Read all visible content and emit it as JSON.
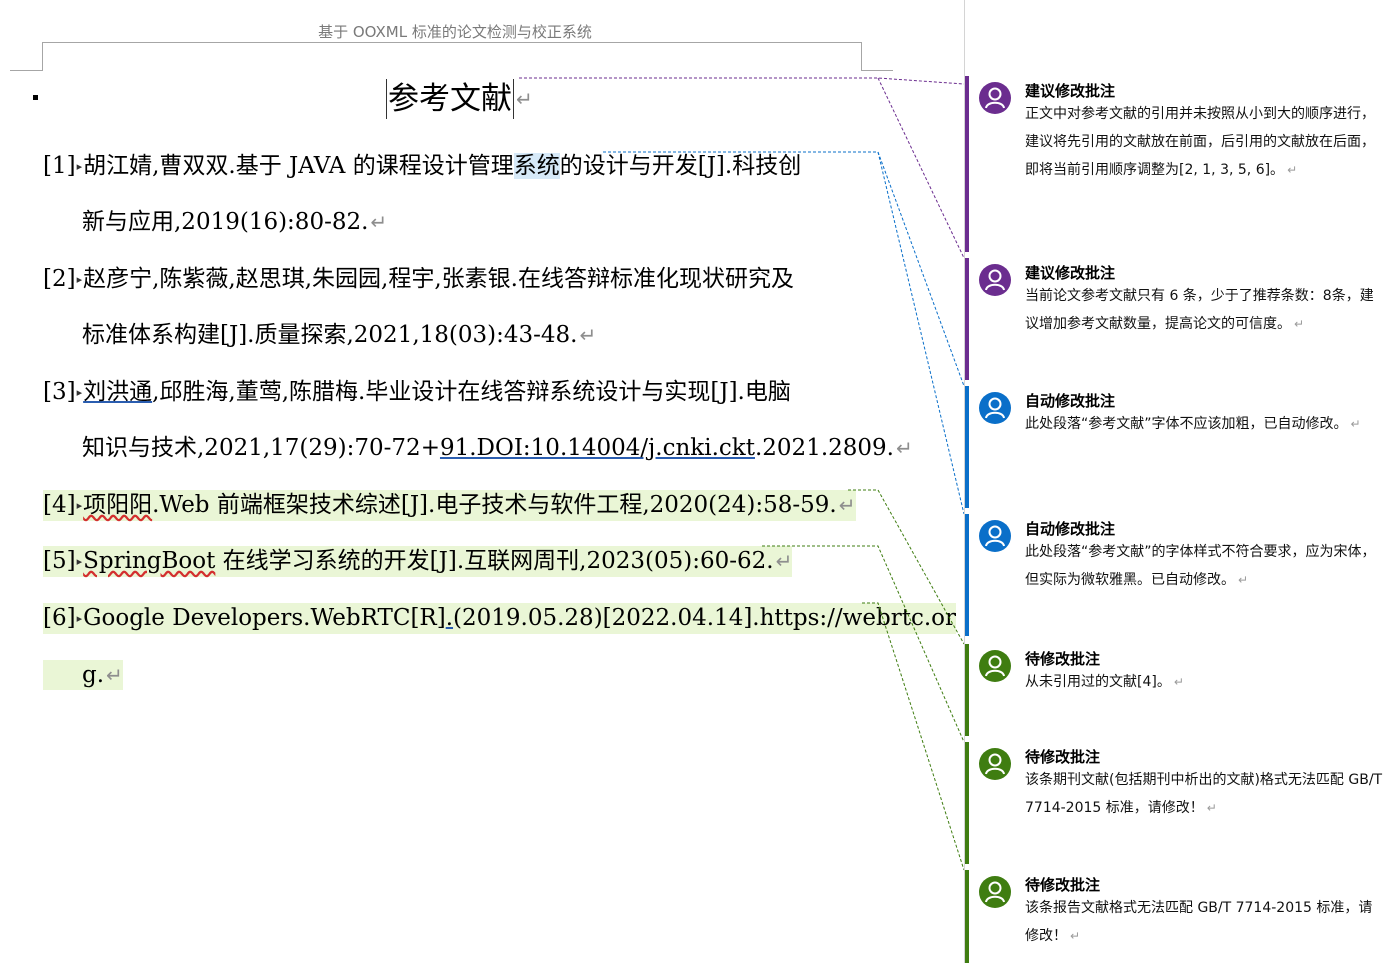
{
  "document": {
    "header_text": "基于 OOXML 标准的论文检测与校正系统",
    "title": "参考文献",
    "paragraph_mark": "↵",
    "tab_arrow": "▸",
    "references": [
      {
        "num": "[1]",
        "lines": [
          {
            "segments": [
              {
                "t": "胡江婧,曹双双.基于 JAVA 的课程设计管理"
              },
              {
                "t": "系统",
                "style": "hl-blue"
              },
              {
                "t": "的设计与开发[J].科技创"
              }
            ]
          },
          {
            "segments": [
              {
                "t": "新与应用,2019(16):80-82."
              }
            ],
            "mark": true
          }
        ]
      },
      {
        "num": "[2]",
        "lines": [
          {
            "segments": [
              {
                "t": "赵彦宁,陈紫薇,赵思琪,朱园园,程宇,张素银.在线答辩标准化现状研究及"
              }
            ]
          },
          {
            "segments": [
              {
                "t": "标准体系构建[J].质量探索,2021,18(03):43-48."
              }
            ],
            "mark": true
          }
        ]
      },
      {
        "num": "[3]",
        "lines": [
          {
            "segments": [
              {
                "t": "刘洪通",
                "style": "ul-blue"
              },
              {
                "t": ",邱胜海,董莺,陈腊梅.毕业设计在线答辩系统设计与实现[J].电脑"
              }
            ]
          },
          {
            "segments": [
              {
                "t": "知识与技术,2021,17(29):70-72+"
              },
              {
                "t": "91.DOI:10.14004/j.cnki.ckt",
                "style": "ul-blue"
              },
              {
                "t": ".2021.2809."
              }
            ],
            "mark": true
          }
        ]
      },
      {
        "num": "[4]",
        "lines": [
          {
            "segments": [
              {
                "t": "项阳阳",
                "style": "wavy"
              },
              {
                "t": ".Web 前端框架技术综述[J].电子技术与软件工程,2020(24):58-59."
              }
            ],
            "mark": true,
            "hl": "green"
          }
        ]
      },
      {
        "num": "[5]",
        "lines": [
          {
            "segments": [
              {
                "t": "SpringBoot",
                "style": "wavy"
              },
              {
                "t": " 在线学习系统的开发[J].互联网周刊,2023(05):60-62."
              }
            ],
            "mark": true,
            "hl": "green"
          }
        ]
      },
      {
        "num": "[6]",
        "lines": [
          {
            "segments": [
              {
                "t": "Google  Developers.WebRTC[R]"
              },
              {
                "t": ".",
                "style": "ul-blue"
              },
              {
                "t": "(2019.05.28)[2022.04.14].https://webrtc.or"
              }
            ],
            "hl": "green"
          },
          {
            "segments": [
              {
                "t": "g."
              }
            ],
            "mark": true,
            "hl": "green"
          }
        ]
      }
    ]
  },
  "comments": [
    {
      "author": "建议修改批注",
      "color": "#6b2d8f",
      "icon": "user-icon",
      "body": "正文中对参考文献的引用并未按照从小到大的顺序进行，建议将先引用的文献放在前面，后引用的文献放在后面，即将当前引用顺序调整为[2, 1, 3, 5, 6]。"
    },
    {
      "author": "建议修改批注",
      "color": "#6b2d8f",
      "icon": "user-icon",
      "body": "当前论文参考文献只有 6 条，少于了推荐条数：8条，建议增加参考文献数量，提高论文的可信度。"
    },
    {
      "author": "自动修改批注",
      "color": "#0a6fc9",
      "icon": "user-icon",
      "body": "此处段落“参考文献”字体不应该加粗，已自动修改。"
    },
    {
      "author": "自动修改批注",
      "color": "#0a6fc9",
      "icon": "user-icon",
      "body": "此处段落“参考文献”的字体样式不符合要求，应为宋体，但实际为微软雅黑。已自动修改。"
    },
    {
      "author": "待修改批注",
      "color": "#3f7d11",
      "icon": "user-icon",
      "body": "从未引用过的文献[4]。"
    },
    {
      "author": "待修改批注",
      "color": "#3f7d11",
      "icon": "user-icon",
      "body": "该条期刊文献(包括期刊中析出的文献)格式无法匹配 GB/T 7714-2015 标准，请修改！"
    },
    {
      "author": "待修改批注",
      "color": "#3f7d11",
      "icon": "user-icon",
      "body": "该条报告文献格式无法匹配 GB/T 7714-2015 标准，请修改！"
    }
  ]
}
